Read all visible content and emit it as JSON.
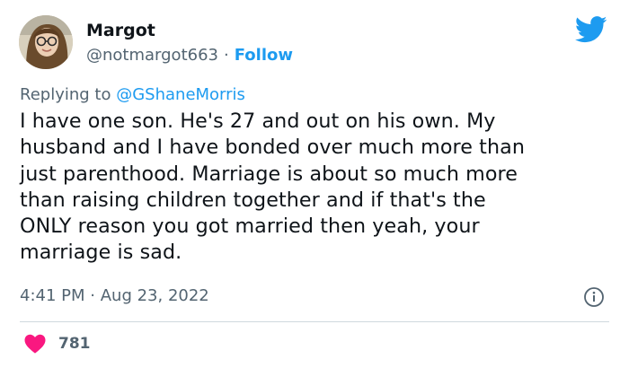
{
  "author": {
    "name": "Margot",
    "handle": "@notmargot663",
    "follow_label": "Follow"
  },
  "platform_icon": "twitter-bird-icon",
  "reply": {
    "prefix": "Replying to",
    "mention": "@GShaneMorris"
  },
  "tweet_text": "I have one son. He's 27 and out on his own. My\nhusband and I have bonded over much more than\njust parenthood. Marriage is about so much more\nthan raising children together and if that's the\nONLY reason you got married then yeah, your\nmarriage is sad.",
  "meta": {
    "time": "4:41 PM",
    "separator": "·",
    "date": "Aug 23, 2022"
  },
  "engagement": {
    "likes": "781"
  },
  "colors": {
    "accent": "#1d9bf0",
    "heart": "#f91880",
    "secondary_text": "#536471",
    "primary_text": "#0f1419"
  }
}
